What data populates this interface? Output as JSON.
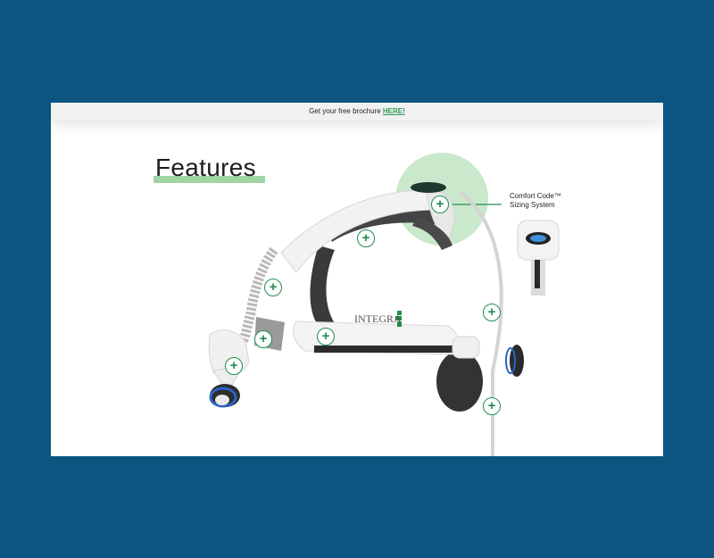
{
  "topbar": {
    "text": "Get your free brochure ",
    "link_label": "HERE!"
  },
  "page": {
    "title": "Features"
  },
  "callout": {
    "line1": "Comfort Code™",
    "line2": "Sizing System"
  },
  "product": {
    "brand_label": "INTEGRA"
  },
  "hotspots": [
    "+",
    "+",
    "+",
    "+",
    "+",
    "+",
    "+",
    "+"
  ],
  "colors": {
    "background": "#0c5580",
    "accent_green": "#1f8f4c",
    "highlight_green": "#9ed6a3",
    "brochure_link": "#2e9b52"
  }
}
